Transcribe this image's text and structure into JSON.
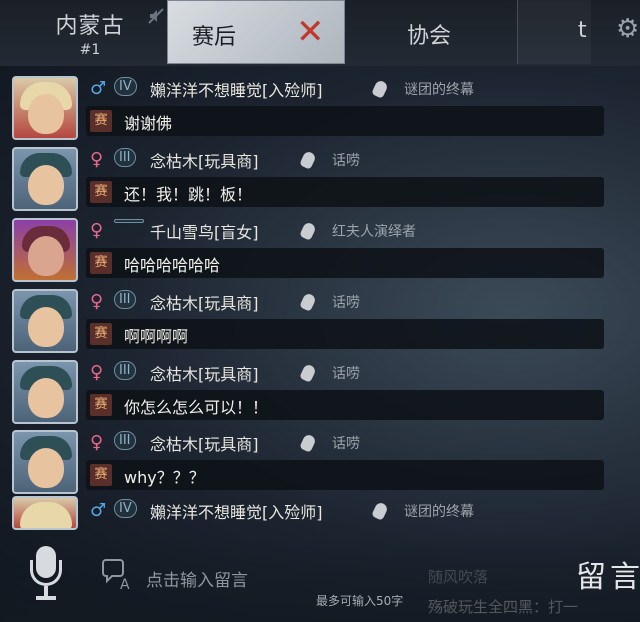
{
  "topbar": {
    "region_name": "内蒙古",
    "region_rank": "#1",
    "tabs": {
      "postmatch": "赛后",
      "postmatch_close": "✕",
      "guild": "协会",
      "edge": "t",
      "settings": "⚙"
    }
  },
  "messages": [
    {
      "gender": "♂",
      "tier": "IV",
      "name": "嬾洋洋不想睡觉[入殓师]",
      "title": "谜团的终幕",
      "tag": "赛",
      "text": "谢谢佛",
      "avatar": "embalmer"
    },
    {
      "gender": "♀",
      "tier": "III",
      "name": "念枯木[玩具商]",
      "title": "话唠",
      "tag": "赛",
      "text": "还！我！跳！板！",
      "avatar": "detective"
    },
    {
      "gender": "♀",
      "tier": "",
      "name": "千山雪鸟[盲女]",
      "title": "红夫人演绎者",
      "tag": "赛",
      "text": "哈哈哈哈哈哈",
      "avatar": "blind"
    },
    {
      "gender": "♀",
      "tier": "III",
      "name": "念枯木[玩具商]",
      "title": "话唠",
      "tag": "赛",
      "text": "啊啊啊啊",
      "avatar": "detective"
    },
    {
      "gender": "♀",
      "tier": "III",
      "name": "念枯木[玩具商]",
      "title": "话唠",
      "tag": "赛",
      "text": "你怎么怎么可以！！",
      "avatar": "detective"
    },
    {
      "gender": "♀",
      "tier": "III",
      "name": "念枯木[玩具商]",
      "title": "话唠",
      "tag": "赛",
      "text": "why？？？",
      "avatar": "detective"
    }
  ],
  "partial_message": {
    "gender": "♂",
    "tier": "IV",
    "name": "嬾洋洋不想睡觉[入殓师]",
    "title": "谜团的终幕"
  },
  "input": {
    "placeholder": "点击输入留言",
    "limit": "最多可输入50字",
    "faint_line1": "随风吹落",
    "faint_line2": "殇破玩生全四黑：打一",
    "post_label": "留言"
  },
  "colors": {
    "male": "#5aa7e0",
    "female": "#e36a8a",
    "tag_bg": "#5a2f29",
    "tag_fg": "#f0b27a"
  }
}
